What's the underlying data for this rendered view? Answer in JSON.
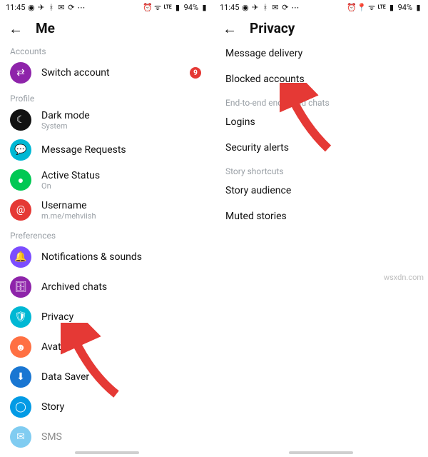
{
  "status": {
    "time": "11:45",
    "battery_pct": "94%"
  },
  "left": {
    "title": "Me",
    "sections": {
      "accounts_label": "Accounts",
      "switch_account": "Switch account",
      "switch_badge": "9",
      "profile_label": "Profile",
      "dark_mode": "Dark mode",
      "dark_mode_sub": "System",
      "message_requests": "Message Requests",
      "active_status": "Active Status",
      "active_status_sub": "On",
      "username": "Username",
      "username_sub": "m.me/mehviish",
      "preferences_label": "Preferences",
      "notifications": "Notifications & sounds",
      "archived": "Archived chats",
      "privacy": "Privacy",
      "avatar": "Avatar",
      "data_saver": "Data Saver",
      "story": "Story",
      "sms": "SMS"
    }
  },
  "right": {
    "title": "Privacy",
    "message_delivery": "Message delivery",
    "blocked_accounts": "Blocked accounts",
    "e2e_label": "End-to-end encrypted chats",
    "logins": "Logins",
    "security_alerts": "Security alerts",
    "story_shortcuts_label": "Story shortcuts",
    "story_audience": "Story audience",
    "muted_stories": "Muted stories"
  },
  "watermark": "wsxdn.com"
}
